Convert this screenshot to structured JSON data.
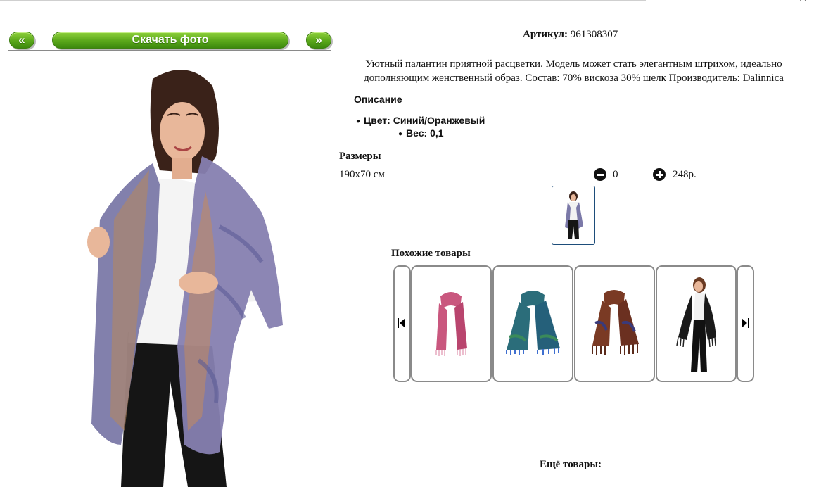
{
  "nav": {
    "prev_label": "«",
    "download_label": "Скачать фото",
    "next_label": "»"
  },
  "product": {
    "article_label": "Артикул:",
    "article_value": "961308307",
    "description": "Уютный палантин приятной расцветки. Модель может стать элегантным штрихом, идеально дополняющим женственный образ. Состав: 70% вискоза 30% шелк Производитель: Dalinnica",
    "desc_heading": "Описание",
    "properties": [
      "Цвет: Синий/Оранжевый",
      "Вес: 0,1"
    ]
  },
  "sizes": {
    "heading": "Размеры",
    "rows": [
      {
        "name": "190х70 см",
        "qty": "0",
        "price": "248р."
      }
    ]
  },
  "similar": {
    "heading": "Похожие товары",
    "items": [
      {
        "icon": "pink-scarf-image",
        "color": "#c9577e"
      },
      {
        "icon": "teal-scarf-image",
        "color": "#2b6d7a"
      },
      {
        "icon": "brown-paisley-scarf-image",
        "color": "#7a3a24"
      },
      {
        "icon": "black-shawl-model-image",
        "color": "#1a1a1a"
      }
    ]
  },
  "more": {
    "heading": "Ещё товары:"
  },
  "colors": {
    "button_green": "#5aa71a",
    "thumb_border": "#1d4d7a"
  }
}
